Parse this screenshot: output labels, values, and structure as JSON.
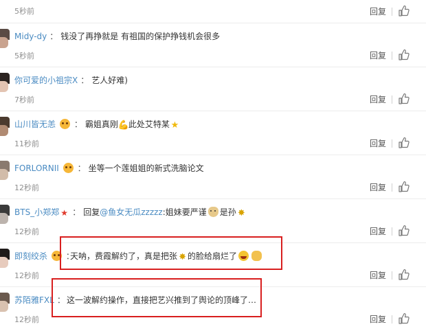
{
  "comments": [
    {
      "time": "5秒前",
      "reply": "回复"
    },
    {
      "user": "Midy-dy",
      "sep": "：",
      "text": "钱没了再挣就是 有祖国的保护挣钱机会很多",
      "time": "5秒前",
      "reply": "回复"
    },
    {
      "user": "你可爱的小祖宗X",
      "sep": "：",
      "text": "艺人好难)",
      "time": "7秒前",
      "reply": "回复"
    },
    {
      "user": "山川皆无恙",
      "sep": "：",
      "text_a": "霸姐真刚",
      "text_b": "此处艾特某",
      "time": "11秒前",
      "reply": "回复"
    },
    {
      "user": "FORLORNII",
      "sep": "：",
      "text": "坐等一个莲姐姐的新式洗脑论文",
      "time": "12秒前",
      "reply": "回复"
    },
    {
      "user": "BTS_小郑郑",
      "sep": "：",
      "text_a": "回复",
      "mention": "@鱼女无瓜zzzzz",
      "text_b": ":姐妹要严谨",
      "text_c": "是孙",
      "time": "12秒前",
      "reply": "回复"
    },
    {
      "user": "即刻绞杀",
      "sep": "：",
      "text_a": "天呐，费霞解约了，真是把张",
      "text_b": "的脸给扇烂了",
      "time": "12秒前",
      "reply": "回复"
    },
    {
      "user": "苏陌雅FXL",
      "sep": "：",
      "text": "这一波解约操作，直接把艺兴推到了舆论的顶峰了…",
      "time": "12秒前",
      "reply": "回复"
    }
  ],
  "icons": {
    "like": "thumbs-up-icon",
    "badge": "crown-emoji-icon",
    "vip": "red-star-icon"
  },
  "colors": {
    "username": "#4a8bc2",
    "time": "#8f8f8f",
    "highlight": "#d81e1e"
  }
}
